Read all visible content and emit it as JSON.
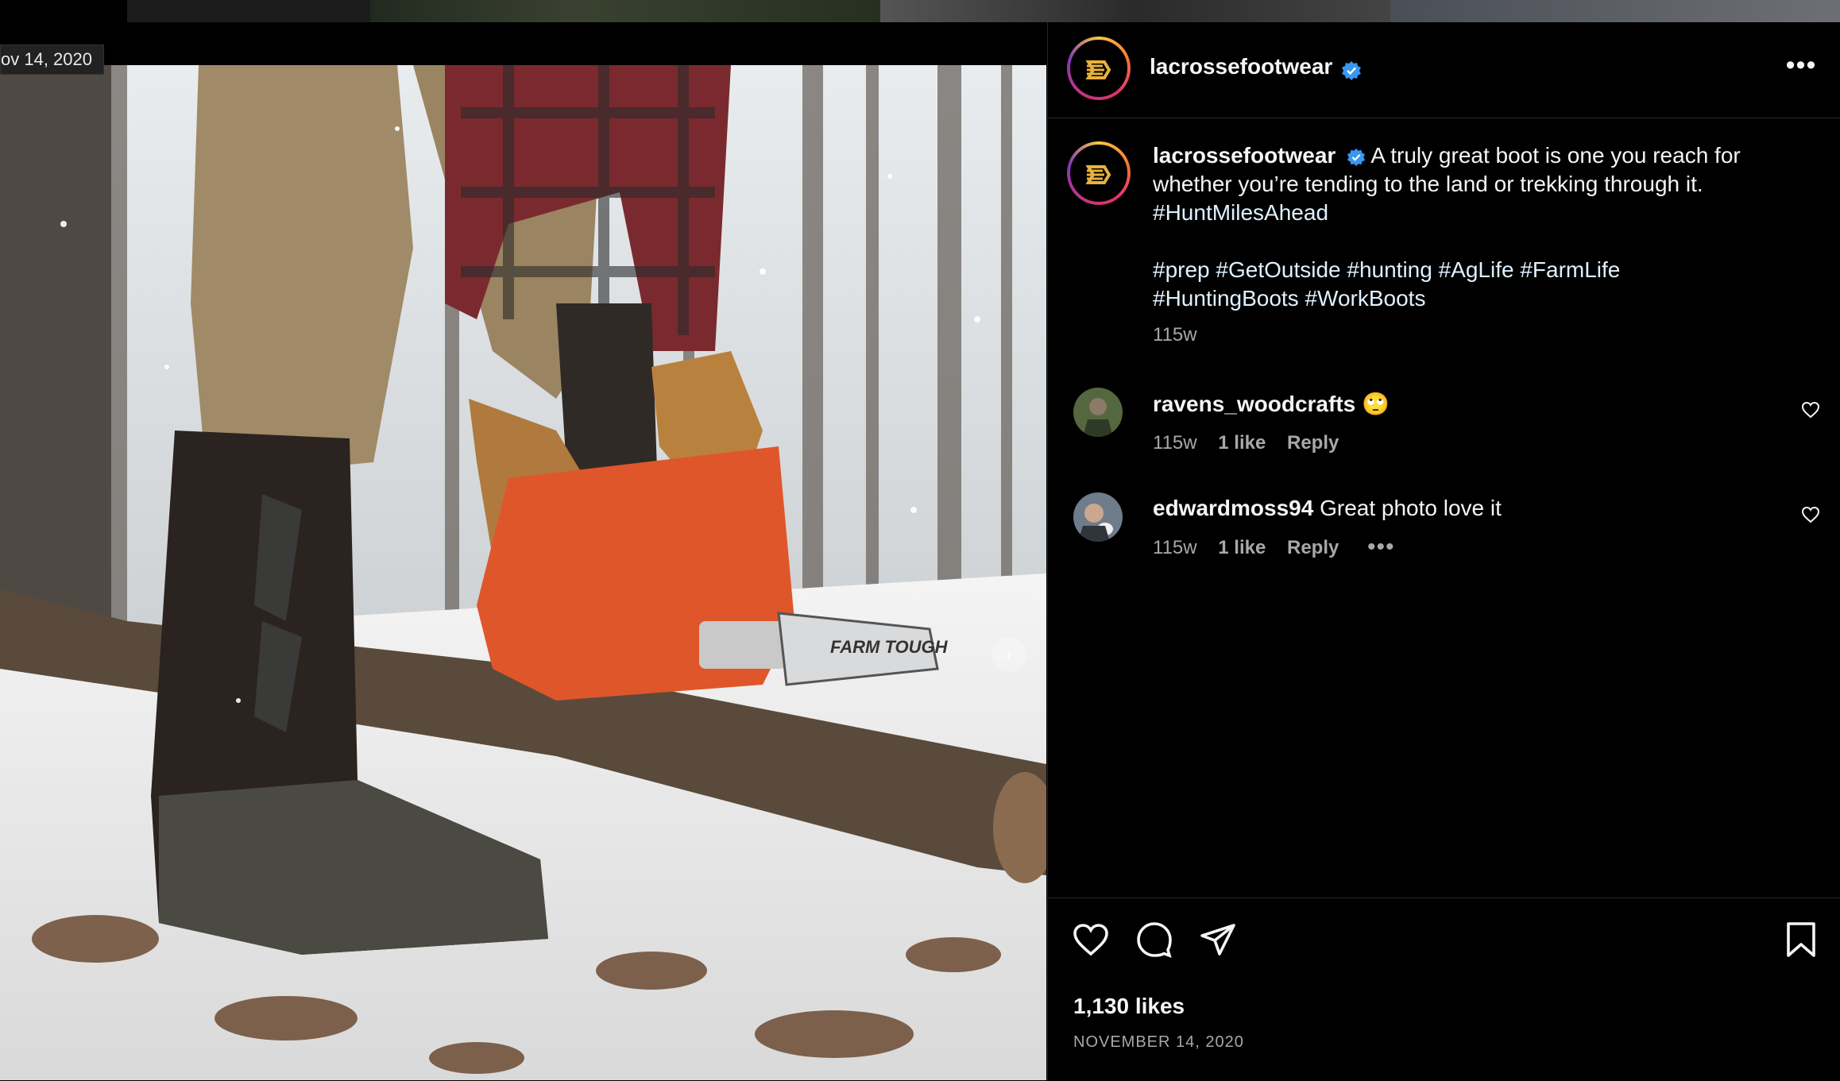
{
  "photo": {
    "date_overlay": "ov 14, 2020",
    "next_arrow": "›"
  },
  "post": {
    "author": "lacrossefootwear",
    "verified": true,
    "caption_line1": "A truly great boot is one you reach for",
    "caption_line2": "whether you’re tending to the land or trekking through it.",
    "caption_line3": "#HuntMilesAhead",
    "caption_tags1": "#prep #GetOutside #hunting #AgLife #FarmLife",
    "caption_tags2": "#HuntingBoots #WorkBoots",
    "caption_time": "115w"
  },
  "comments": [
    {
      "username": "ravens_woodcrafts",
      "text": "🙄",
      "time": "115w",
      "likes": "1 like",
      "reply": "Reply"
    },
    {
      "username": "edwardmoss94",
      "text": "Great photo love it",
      "time": "115w",
      "likes": "1 like",
      "reply": "Reply",
      "more": "•••"
    }
  ],
  "footer": {
    "likes": "1,130 likes",
    "date": "NOVEMBER 14, 2020"
  },
  "icons": {
    "verified": "verified-badge-icon",
    "more": "more-options-icon",
    "like": "heart-icon",
    "comment": "comment-bubble-icon",
    "share": "paper-plane-icon",
    "save": "bookmark-icon"
  },
  "colors": {
    "background": "#000000",
    "text": "#f5f5f5",
    "muted": "#a8a8a8",
    "verified": "#3897f0",
    "hashtag": "#e0f1ff"
  }
}
